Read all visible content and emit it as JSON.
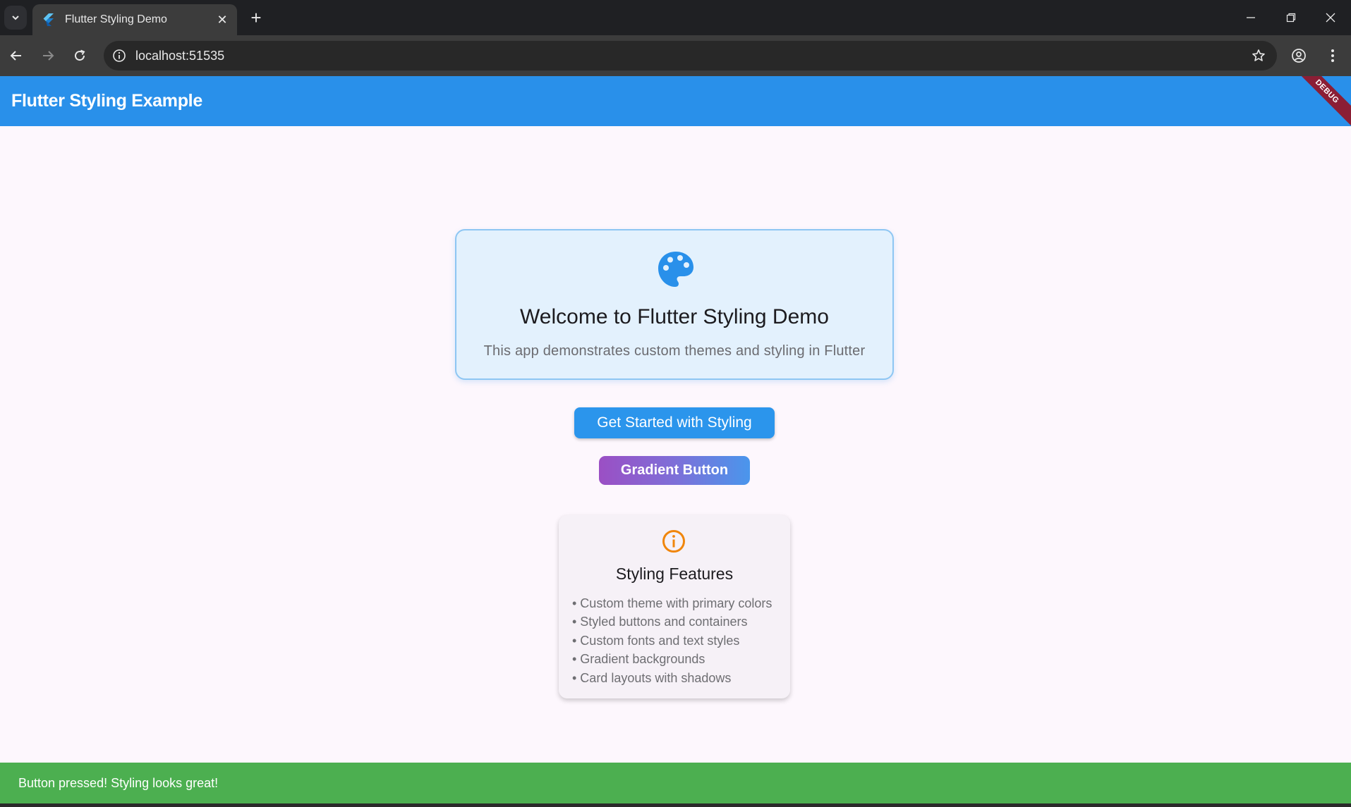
{
  "browser": {
    "tab_title": "Flutter Styling Demo",
    "url": "localhost:51535"
  },
  "app": {
    "title": "Flutter Styling Example",
    "debug_banner": "DEBUG",
    "colors": {
      "primary": "#2990ea",
      "gradient_start": "#9b4fc4",
      "gradient_end": "#4a96ec",
      "info": "#f0860c",
      "snackbar": "#4caf50"
    }
  },
  "welcome": {
    "icon": "palette-icon",
    "title": "Welcome to Flutter Styling Demo",
    "subtitle": "This app demonstrates custom themes and styling in Flutter"
  },
  "buttons": {
    "primary_label": "Get Started with Styling",
    "gradient_label": "Gradient Button"
  },
  "features": {
    "icon": "info-icon",
    "title": "Styling Features",
    "items": [
      "• Custom theme with primary colors",
      "• Styled buttons and containers",
      "• Custom fonts and text styles",
      "• Gradient backgrounds",
      "• Card layouts with shadows"
    ]
  },
  "snackbar": {
    "message": "Button pressed! Styling looks great!"
  }
}
